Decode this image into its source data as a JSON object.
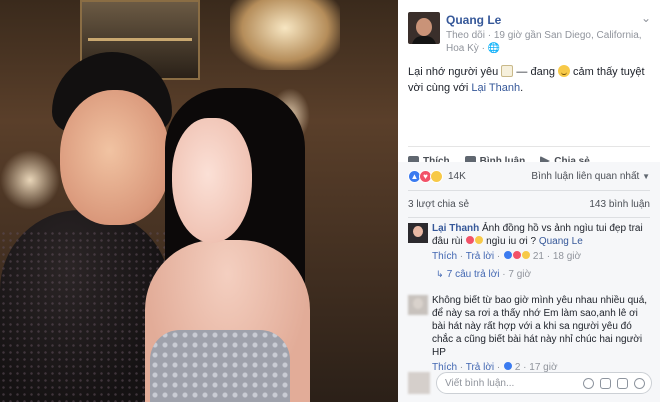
{
  "post": {
    "author": "Quang Le",
    "meta_follow": "Theo dõi",
    "meta_sep": " · ",
    "meta_time": "19 giờ gần San Diego, California, Hoa Kỳ",
    "meta_privacy": " · ",
    "text_part1": "Lại nhớ người yêu ",
    "text_part2": " — đang ",
    "text_part3": " cảm thấy tuyệt vời cùng với ",
    "tagged": "Lại Thanh",
    "text_end": "."
  },
  "actions": {
    "like": "Thích",
    "comment": "Bình luận",
    "share": "Chia sẻ"
  },
  "reactions": {
    "count": "14K",
    "sort": "Bình luận liên quan nhất",
    "icons": [
      "like-icon",
      "heart-icon",
      "haha-icon"
    ]
  },
  "stats": {
    "shares": "3 lượt chia sẻ",
    "comments": "143 bình luận"
  },
  "comments": [
    {
      "author": "Lại Thanh",
      "text_a": " Ảnh đồng hồ vs ảnh ngìu tui đẹp trai đâu rùi",
      "text_b": " ngìu iu ơi ? ",
      "tag": "Quang Le",
      "like": "Thích",
      "reply": "Trả lời",
      "reactions_count": "21",
      "time": "18 giờ",
      "replies_label": "7 câu trả lời",
      "replies_time": "7 giờ"
    },
    {
      "author": "",
      "text": "Không biết từ bao giờ mình yêu nhau nhiều quá, để này sa rơi a thấy nhớ Em làm sao,anh lê ơi bài hát này rất hợp với a khi sa người yêu đó chắc a cũng biết bài hát này nhỉ chúc hai người HP",
      "like": "Thích",
      "reply": "Trả lời",
      "reactions_count": "2",
      "time": "17 giờ"
    }
  ],
  "compose": {
    "placeholder": "Viết bình luận..."
  },
  "colors": {
    "link": "#365899",
    "action_blue": "#4267b2",
    "meta_gray": "#90949c",
    "gray_bg": "#f6f7f9"
  }
}
